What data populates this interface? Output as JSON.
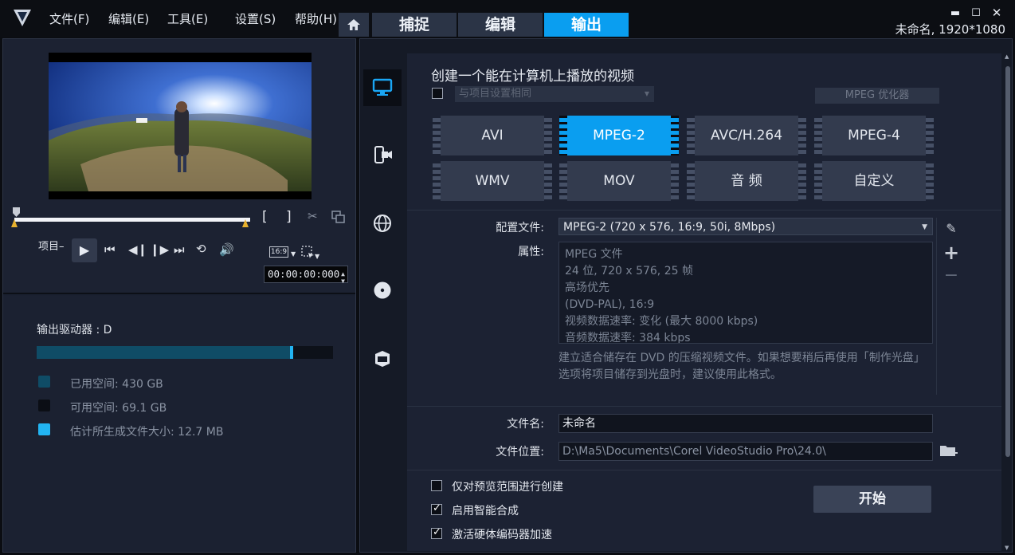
{
  "menu": {
    "file": "文件(F)",
    "edit": "编辑(E)",
    "tools": "工具(E)",
    "settings": "设置(S)",
    "help": "帮助(H)"
  },
  "tabs": [
    {
      "label": "捕捉"
    },
    {
      "label": "编辑"
    },
    {
      "label": "输出"
    }
  ],
  "window": {
    "project_info": "未命名, 1920*1080"
  },
  "player": {
    "project_label": "项目–",
    "aspect": "16:9",
    "timecode": "00:00:00:000"
  },
  "drive": {
    "title": "输出驱动器 : D",
    "used_fraction": 0.855,
    "estimated_fraction": 0.865,
    "legend": [
      {
        "label": "已用空间:  430 GB",
        "color": "#0f4c66"
      },
      {
        "label": "可用空间:  69.1 GB",
        "color": "#0b0e15"
      },
      {
        "label": "估计所生成文件大小:  12.7 MB",
        "color": "#22b4f2"
      }
    ]
  },
  "output": {
    "heading": "创建一个能在计算机上播放的视频",
    "same_as_project": "与项目设置相同",
    "mpeg_optimizer": "MPEG 优化器",
    "formats": [
      {
        "label": "AVI",
        "active": false
      },
      {
        "label": "MPEG-2",
        "active": true
      },
      {
        "label": "AVC/H.264",
        "active": false
      },
      {
        "label": "MPEG-4",
        "active": false
      },
      {
        "label": "WMV",
        "active": false
      },
      {
        "label": "MOV",
        "active": false
      },
      {
        "label": "音 频",
        "active": false
      },
      {
        "label": "自定义",
        "active": false
      }
    ],
    "profile_label": "配置文件:",
    "profile_value": "MPEG-2 (720 x 576, 16:9, 50i, 8Mbps)",
    "properties_label": "属性:",
    "properties": [
      "MPEG 文件",
      "24 位, 720 x 576, 25 帧",
      "高场优先",
      "(DVD-PAL),  16:9",
      "视频数据速率: 变化 (最大  8000 kbps)",
      "音频数据速率: 384 kbps"
    ],
    "description": "建立适合储存在 DVD 的压缩视频文件。如果想要稍后再使用「制作光盘」选项将项目储存到光盘时，建议使用此格式。",
    "filename_label": "文件名:",
    "filename_value": "未命名",
    "location_label": "文件位置:",
    "location_value": "D:\\Ma5\\Documents\\Corel VideoStudio Pro\\24.0\\",
    "options": [
      {
        "label": "仅对预览范围进行创建",
        "checked": false
      },
      {
        "label": "启用智能合成",
        "checked": true
      },
      {
        "label": "激活硬体编码器加速",
        "checked": true
      }
    ],
    "start": "开始"
  }
}
